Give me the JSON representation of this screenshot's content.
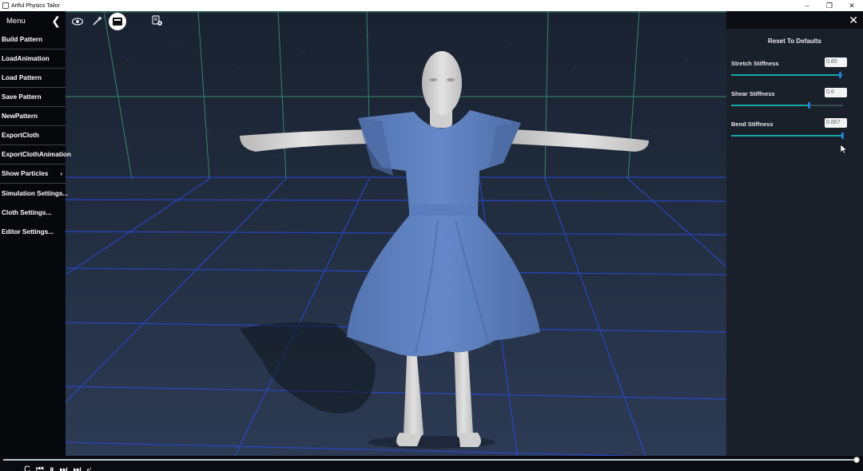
{
  "window": {
    "title": "Artful Physics Tailor",
    "minimize": "–",
    "restore": "❐",
    "close": "✕"
  },
  "menu": {
    "title": "Menu",
    "collapse_glyph": "❮",
    "items": [
      {
        "label": "Build Pattern"
      },
      {
        "label": "LoadAnimation"
      },
      {
        "label": "Load Pattern"
      },
      {
        "label": "Save Pattern"
      },
      {
        "label": "NewPattern"
      },
      {
        "label": "ExportCloth"
      },
      {
        "label": "ExportClothAnimation"
      },
      {
        "label": "Show Particles",
        "arrow": "›"
      },
      {
        "label": "Simulation Settings..."
      },
      {
        "label": "Cloth Settings..."
      },
      {
        "label": "Editor Settings..."
      }
    ]
  },
  "toolbar": {
    "icons": [
      "eye-icon",
      "wand-icon",
      "mannequin-mode-icon",
      "settings-database-icon"
    ]
  },
  "settings_panel": {
    "close_glyph": "✕",
    "reset_label": "Reset To Defaults",
    "sliders": [
      {
        "label": "Stretch Stiffness",
        "value": "0.85",
        "fraction": 0.98
      },
      {
        "label": "Shear Stiffness",
        "value": "0.6",
        "fraction": 0.7
      },
      {
        "label": "Bend Stiffness",
        "value": "0.867",
        "fraction": 1.0
      }
    ]
  },
  "timeline": {
    "progress": 1.0,
    "controls": "C ⏮ ⏸ ⏭ ⏭ ⤶"
  },
  "colors": {
    "dress": "#5f82c2",
    "skin": "#d9d9d9",
    "grid_wall": "#3fa57a",
    "grid_floor": "#2a4ad8",
    "slider_fill": "#16a6a6",
    "slider_thumb": "#1e7fe0"
  }
}
